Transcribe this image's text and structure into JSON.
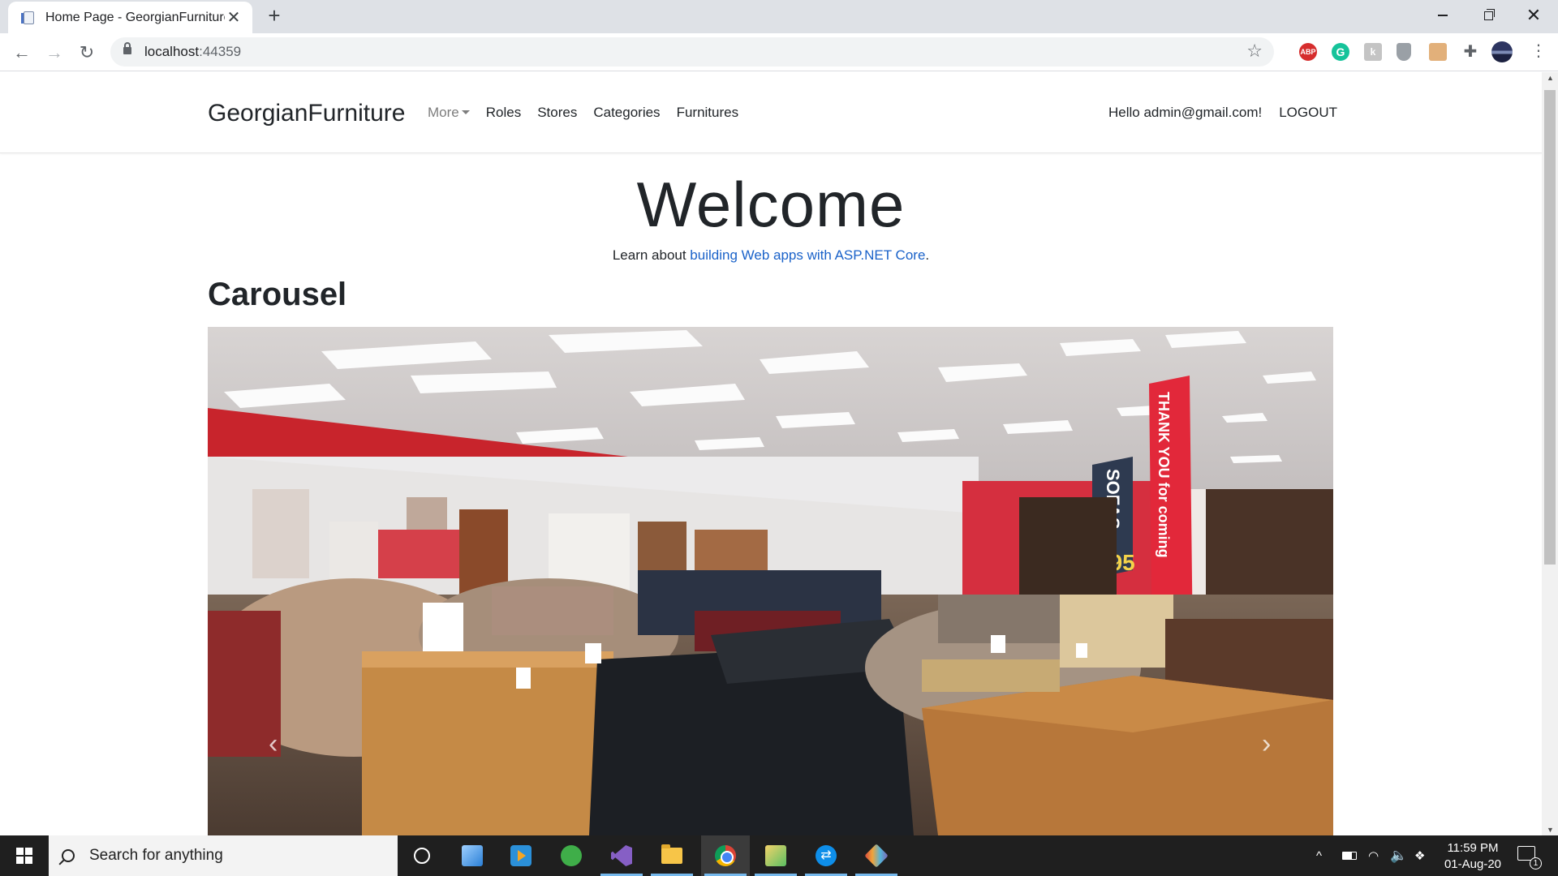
{
  "browser": {
    "tab_title": "Home Page - GeorgianFurniture",
    "tab_close": "✕",
    "new_tab": "+",
    "url_host": "localhost",
    "url_port": ":44359",
    "back": "←",
    "forward": "→",
    "reload": "↻",
    "star": "☆",
    "menu": "⋮",
    "extensions": {
      "abp": "ABP",
      "grammarly": "G",
      "k": "k",
      "puzzle": "✚"
    }
  },
  "site": {
    "brand": "GeorgianFurniture",
    "nav": {
      "more": "More",
      "roles": "Roles",
      "stores": "Stores",
      "categories": "Categories",
      "furnitures": "Furnitures"
    },
    "user_greeting": "Hello admin@gmail.com!",
    "logout": "LOGOUT"
  },
  "main": {
    "welcome": "Welcome",
    "learn_prefix": "Learn about ",
    "learn_link": "building Web apps with ASP.NET Core",
    "learn_suffix": ".",
    "carousel_heading": "Carousel",
    "carousel_prev": "‹",
    "carousel_next": "›",
    "store_banner_sofas": "SOFAS",
    "store_banner_price": "£95",
    "store_pillar_text": "THANK YOU for coming"
  },
  "taskbar": {
    "search_placeholder": "Search for anything",
    "time": "11:59 PM",
    "date": "01-Aug-20",
    "notification_count": "1",
    "tray_chevron": "^",
    "tray_wifi": "◠",
    "tray_volume": "🔈",
    "tray_dropbox": "❖"
  }
}
